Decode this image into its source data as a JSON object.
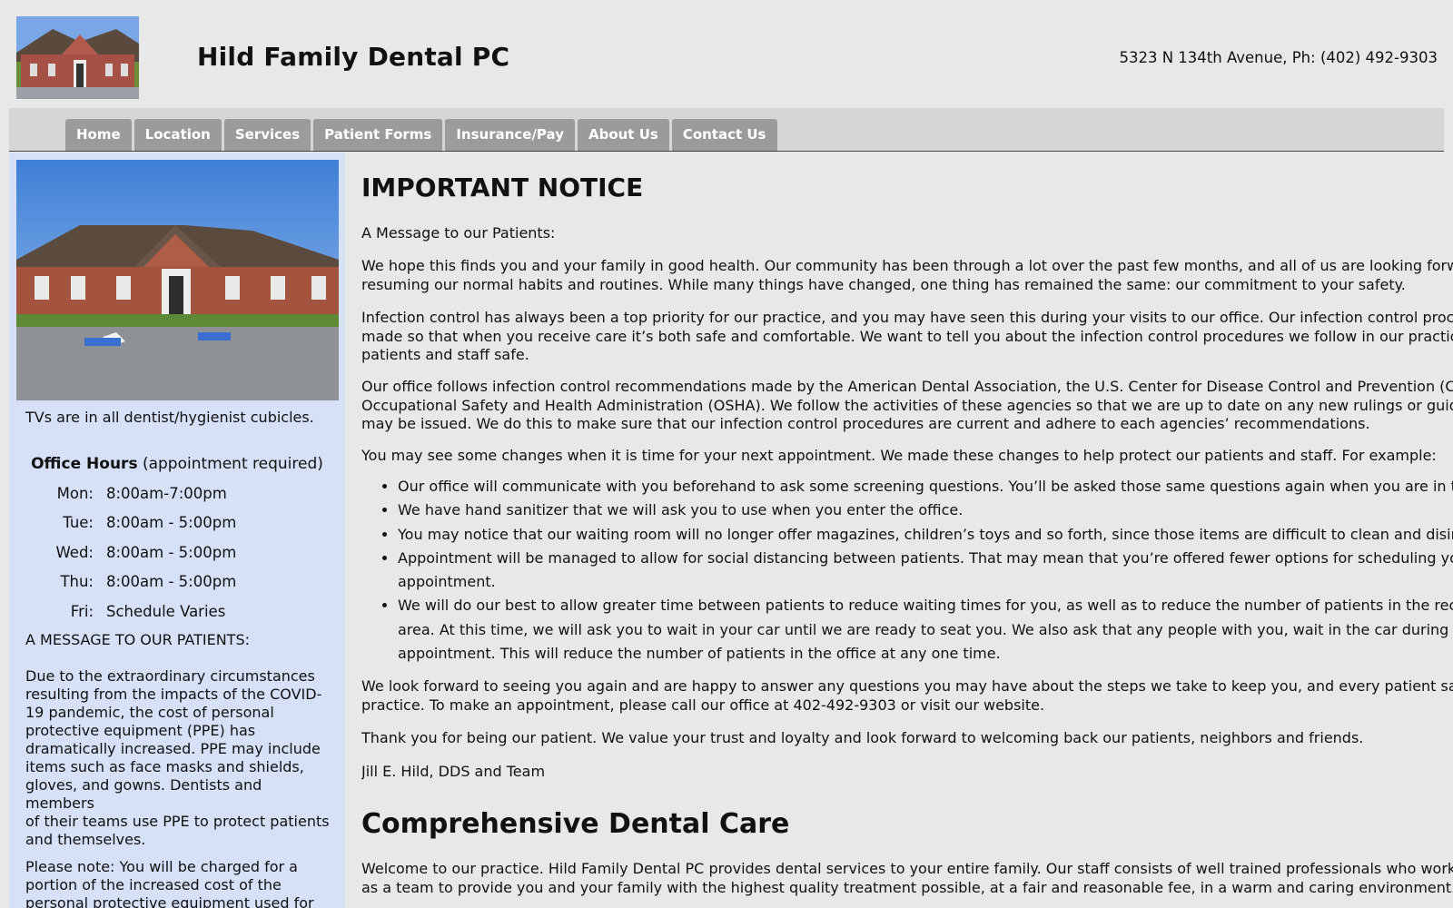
{
  "header": {
    "title": "Hild Family Dental PC",
    "address": "5323 N 134th Avenue, Ph: (402) 492-9303"
  },
  "nav": {
    "tabs": [
      "Home",
      "Location",
      "Services",
      "Patient Forms",
      "Insurance/Pay",
      "About Us",
      "Contact Us"
    ]
  },
  "sidebar": {
    "tv_note": "TVs are in all dentist/hygienist cubicles.",
    "hours_title_bold": "Office Hours",
    "hours_title_rest": "(appointment required)",
    "hours": [
      {
        "day": "Mon:",
        "time": "8:00am-7:00pm"
      },
      {
        "day": "Tue:",
        "time": "8:00am - 5:00pm"
      },
      {
        "day": "Wed:",
        "time": "8:00am - 5:00pm"
      },
      {
        "day": "Thu:",
        "time": "8:00am - 5:00pm"
      },
      {
        "day": "Fri:",
        "time": "Schedule Varies"
      }
    ],
    "message_heading": "A MESSAGE TO OUR PATIENTS:",
    "message_lines": [
      "Due to the extraordinary circumstances",
      "resulting from the impacts of the COVID-",
      "19 pandemic, the cost of personal",
      "protective equipment (PPE) has",
      "dramatically increased. PPE may include",
      "items such as face masks and shields,",
      "gloves, and gowns. Dentists and members",
      "of their teams use PPE to protect patients",
      "and themselves."
    ],
    "note_lines": [
      "Please note: You will be charged for a",
      "portion of the increased cost of the",
      "personal protective equipment used for"
    ]
  },
  "main": {
    "notice_title": "IMPORTANT NOTICE",
    "greeting": "A Message to our Patients:",
    "para1": [
      "We hope this finds you and your family in good health. Our community has been through a lot over the past few months, and all of us are looking forward to",
      "resuming our normal habits and routines. While many things have changed, one thing has remained the same: our commitment to your safety."
    ],
    "para2": [
      "Infection control has always been a top priority for our practice, and you may have seen this during your visits to our office. Our infection control processes are",
      "made so that when you receive care it’s both safe and comfortable. We want to tell you about the infection control procedures we follow in our practice to keep",
      "patients and staff safe."
    ],
    "para3": [
      "Our office follows infection control recommendations made by the American Dental Association, the U.S. Center for Disease Control and Prevention (CDC) and the",
      "Occupational Safety and Health Administration (OSHA). We follow the activities of these agencies so that we are up to date on any new rulings or guidance that",
      "may be issued. We do this to make sure that our infection control procedures are current and adhere to each agencies’ recommendations."
    ],
    "para4": "You may see some changes when it is time for your next appointment. We made these changes to help protect our patients and staff. For example:",
    "bullets": [
      [
        "Our office will communicate with you beforehand to ask some screening questions. You’ll be asked those same questions again when you are in the office."
      ],
      [
        "We have hand sanitizer that we will ask you to use when you enter the office."
      ],
      [
        "You may notice that our waiting room will no longer offer magazines, children’s toys and so forth, since those items are difficult to clean and disinfect."
      ],
      [
        "Appointment will be managed to allow for social distancing between patients. That may mean that you’re offered fewer options for scheduling your",
        "appointment."
      ],
      [
        "We will do our best to allow greater time between patients to reduce waiting times for you, as well as to reduce the number of patients in the reception",
        "area. At this time, we will ask you to wait in your car until we are ready to seat you. We also ask that any people with you, wait in the car during your",
        "appointment. This will reduce the number of patients in the office at any one time."
      ]
    ],
    "para5": [
      "We look forward to seeing you again and are happy to answer any questions you may have about the steps we take to keep you, and every patient safe in our",
      "practice. To make an appointment, please call our office at 402-492-9303 or visit our website."
    ],
    "para6": "Thank you for being our patient. We value your trust and loyalty and look forward to welcoming back our patients, neighbors and friends.",
    "signature": "Jill E. Hild, DDS and Team",
    "care_title": "Comprehensive Dental Care",
    "para7": [
      "Welcome to our practice. Hild Family Dental PC provides dental services to your entire family. Our staff consists of well trained professionals who work together",
      "as a team to provide you and your family with the highest quality treatment possible, at a fair and reasonable fee, in a warm and caring environment."
    ]
  }
}
